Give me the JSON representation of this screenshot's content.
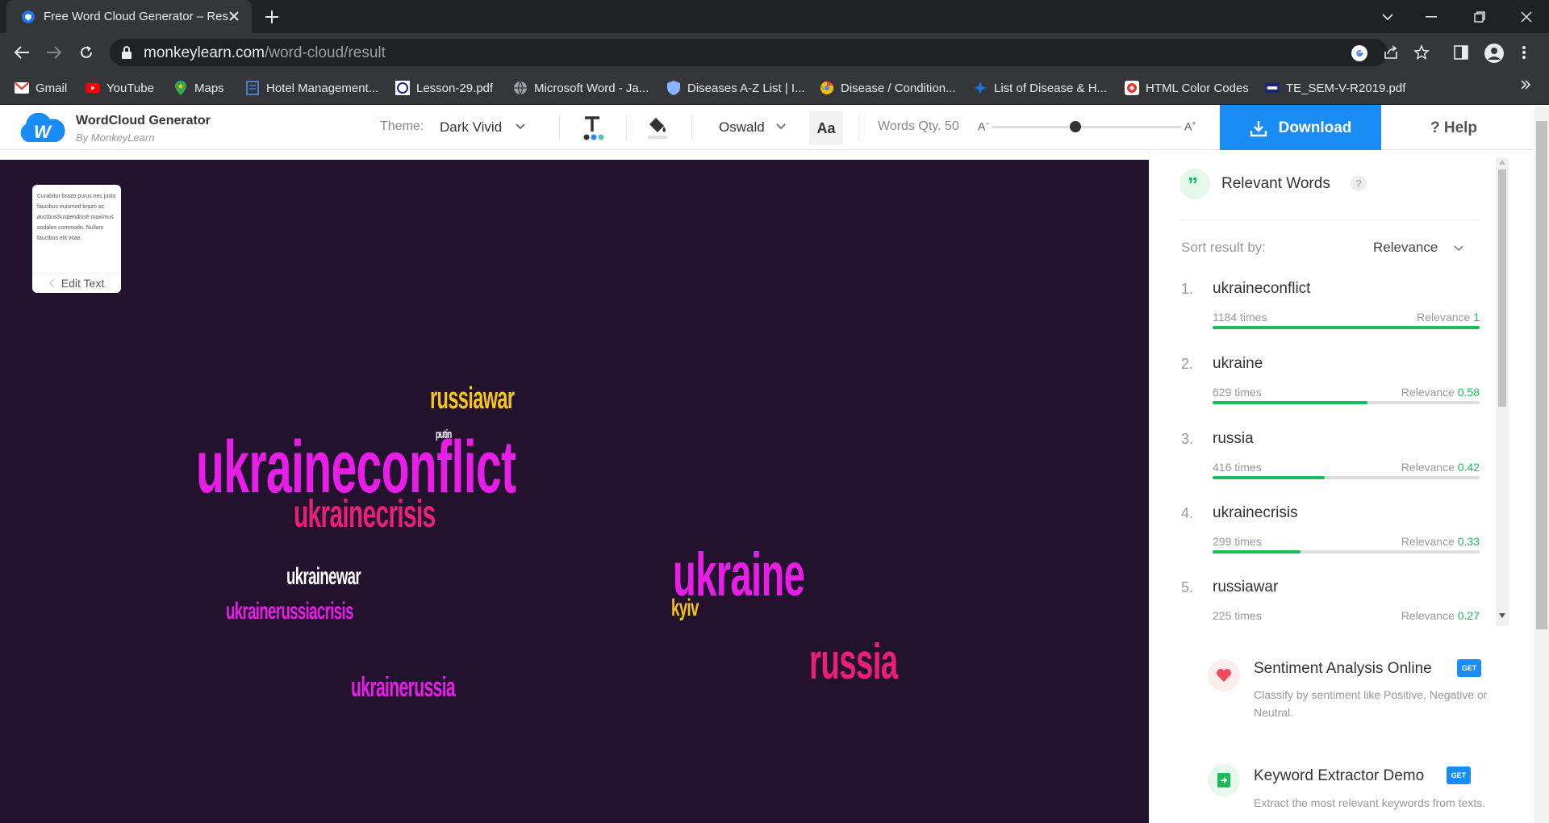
{
  "browser": {
    "tab_title": "Free Word Cloud Generator – Results",
    "url_host": "monkeylearn.com",
    "url_path": "/word-cloud/result",
    "bookmarks": [
      {
        "label": "Gmail",
        "icon": "gmail-icon"
      },
      {
        "label": "YouTube",
        "icon": "youtube-icon"
      },
      {
        "label": "Maps",
        "icon": "maps-icon"
      },
      {
        "label": "Hotel Management...",
        "icon": "page-icon"
      },
      {
        "label": "Lesson-29.pdf",
        "icon": "pdf-icon"
      },
      {
        "label": "Microsoft Word - Ja...",
        "icon": "globe-icon"
      },
      {
        "label": "Diseases A-Z List | I...",
        "icon": "shield-icon"
      },
      {
        "label": "Disease / Condition...",
        "icon": "chrome-icon"
      },
      {
        "label": "List of Disease & H...",
        "icon": "star-icon"
      },
      {
        "label": "HTML Color Codes",
        "icon": "color-icon"
      },
      {
        "label": "TE_SEM-V-R2019.pdf",
        "icon": "pdf-icon"
      }
    ]
  },
  "header": {
    "brand": "WordCloud Generator",
    "brand_sub": "By MonkeyLearn",
    "theme_label": "Theme:",
    "theme_value": "Dark Vivid",
    "font_value": "Oswald",
    "font_size_icon": "Aa",
    "words_qty_label": "Words Qty. 50",
    "slider_min": "A",
    "slider_max": "A",
    "slider_level": 0.44,
    "download": "Download",
    "help": "? Help"
  },
  "editor": {
    "preview_text": "Curabitur brazo purus nec justo faucibus euismod brazo ac auctbusSuspendissé maximus sodales commodo. Nullam faucibus elit vitae.",
    "edit_label": "Edit Text"
  },
  "cloud": {
    "words": [
      {
        "text": "ukraineconflict",
        "color": "#e81ee8"
      },
      {
        "text": "ukraine",
        "color": "#e81ee8"
      },
      {
        "text": "russia",
        "color": "#e8207a"
      },
      {
        "text": "ukrainecrisis",
        "color": "#e8207a"
      },
      {
        "text": "russiawar",
        "color": "#f5c518"
      },
      {
        "text": "ukrainewar",
        "color": "#ffffff"
      },
      {
        "text": "ukrainerussiacrisis",
        "color": "#e81ee8"
      },
      {
        "text": "ukrainerussia",
        "color": "#e81ee8"
      },
      {
        "text": "kyiv",
        "color": "#f5c518"
      },
      {
        "text": "putin",
        "color": "#ffffff"
      }
    ]
  },
  "relevant": {
    "title": "Relevant Words",
    "help": "?",
    "sort_label": "Sort result by:",
    "sort_value": "Relevance",
    "relevance_label": "Relevance",
    "items": [
      {
        "rank": "1.",
        "term": "ukraineconflict",
        "times": "1184 times",
        "relevance": "1",
        "level": 1.0
      },
      {
        "rank": "2.",
        "term": "ukraine",
        "times": "629 times",
        "relevance": "0.58",
        "level": 0.58
      },
      {
        "rank": "3.",
        "term": "russia",
        "times": "416 times",
        "relevance": "0.42",
        "level": 0.42
      },
      {
        "rank": "4.",
        "term": "ukrainecrisis",
        "times": "299 times",
        "relevance": "0.33",
        "level": 0.33
      },
      {
        "rank": "5.",
        "term": "russiawar",
        "times": "225 times",
        "relevance": "0.27",
        "level": 0.27
      }
    ]
  },
  "promos": [
    {
      "title": "Sentiment Analysis Online",
      "desc": "Classify by sentiment like Positive, Negative or Neutral.",
      "badge": "GET"
    },
    {
      "title": "Keyword Extractor Demo",
      "desc": "Extract the most relevant keywords from texts.",
      "badge": "GET"
    }
  ],
  "colors": {
    "accent": "#1a8cf6",
    "canvas_bg": "#23122e",
    "relevance_green": "#1bbb5a"
  }
}
